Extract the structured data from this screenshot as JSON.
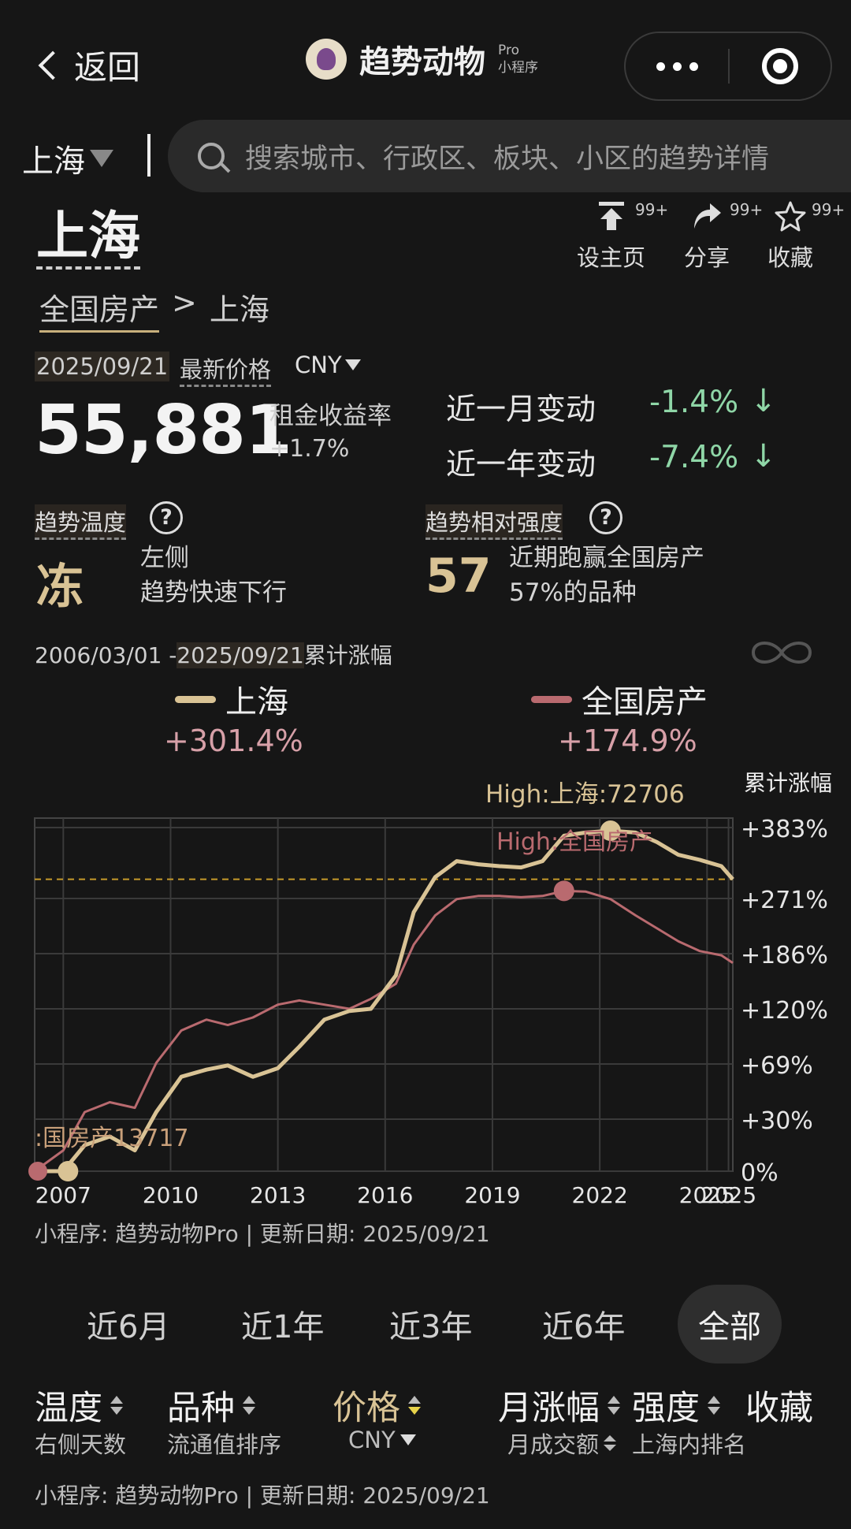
{
  "nav": {
    "back_label": "返回",
    "app_name": "趋势动物",
    "app_pro": "Pro",
    "app_sub": "小程序"
  },
  "city_selector": {
    "city": "上海"
  },
  "search": {
    "placeholder": "搜索城市、行政区、板块、小区的趋势详情"
  },
  "header": {
    "title": "上海",
    "breadcrumb_root": "全国房产",
    "breadcrumb_sep": ">",
    "breadcrumb_current": "上海",
    "actions": [
      {
        "label": "设主页",
        "badge": "99+",
        "icon": "pin-top-icon"
      },
      {
        "label": "分享",
        "badge": "99+",
        "icon": "share-icon"
      },
      {
        "label": "收藏",
        "badge": "99+",
        "icon": "star-icon"
      }
    ]
  },
  "price": {
    "date": "2025/09/21",
    "latest_label": "最新价格",
    "currency": "CNY",
    "value": "55,881",
    "rent_label": "租金收益率",
    "rent_value": "+1.7%",
    "month_label": "近一月变动",
    "month_value": "-1.4%",
    "year_label": "近一年变动",
    "year_value": "-7.4%",
    "arrow": "↓",
    "change_color": "#8fd6a7"
  },
  "metrics": {
    "temp_label": "趋势温度",
    "temp_value": "冻",
    "temp_desc1": "左侧",
    "temp_desc2": "趋势快速下行",
    "strength_label": "趋势相对强度",
    "strength_value": "57",
    "strength_desc1": "近期跑赢全国房产",
    "strength_desc2": "57%的品种",
    "help": "?"
  },
  "chart_header": {
    "range_start": "2006/03/01 -",
    "range_end": "2025/09/21",
    "range_suffix": "累计涨幅",
    "legend": [
      {
        "name": "上海",
        "value": "+301.4%",
        "color": "#d9c395"
      },
      {
        "name": "全国房产",
        "value": "+174.9%",
        "color": "#b96a6f"
      }
    ],
    "cum_label": "累计涨幅"
  },
  "chart_data": {
    "type": "line",
    "ylabel": "累计涨幅",
    "y_ticks": [
      "+383%",
      "+271%",
      "+186%",
      "+120%",
      "+69%",
      "+30%",
      "0%"
    ],
    "x_ticks": [
      "2007",
      "2010",
      "2013",
      "2016",
      "2019",
      "2022",
      "2025",
      "2025"
    ],
    "annotations": {
      "high_shanghai": "High:上海:72706",
      "high_national": "High:全国房产",
      "low_overlap": ":国房产13717"
    },
    "x": [
      2006.2,
      2007.0,
      2007.6,
      2008.3,
      2009.0,
      2009.6,
      2010.3,
      2011.0,
      2011.6,
      2012.3,
      2013.0,
      2013.6,
      2014.3,
      2015.0,
      2015.6,
      2016.3,
      2016.8,
      2017.4,
      2018.0,
      2018.6,
      2019.2,
      2019.8,
      2020.4,
      2021.0,
      2021.6,
      2022.3,
      2023.0,
      2023.6,
      2024.2,
      2024.8,
      2025.4,
      2025.72
    ],
    "series": [
      {
        "name": "上海",
        "color": "#d9c395",
        "values": [
          0,
          0,
          15,
          20,
          12,
          35,
          60,
          65,
          68,
          60,
          66,
          85,
          110,
          118,
          120,
          160,
          250,
          305,
          330,
          325,
          322,
          320,
          330,
          370,
          375,
          378,
          375,
          360,
          340,
          332,
          322,
          301.4
        ]
      },
      {
        "name": "全国房产",
        "color": "#b96a6f",
        "values": [
          0,
          12,
          35,
          42,
          38,
          70,
          100,
          110,
          105,
          112,
          125,
          130,
          125,
          120,
          132,
          150,
          200,
          245,
          270,
          275,
          275,
          273,
          275,
          283,
          282,
          270,
          245,
          225,
          205,
          190,
          184,
          174.9
        ]
      }
    ],
    "reference_line": 301.4
  },
  "chart_footer": "小程序: 趋势动物Pro | 更新日期: 2025/09/21",
  "period_tabs": [
    "近6月",
    "近1年",
    "近3年",
    "近6年",
    "全部"
  ],
  "table_header": {
    "columns": [
      {
        "label": "温度",
        "sub": "右侧天数"
      },
      {
        "label": "品种",
        "sub": "流通值排序"
      },
      {
        "label": "价格",
        "sub": "CNY"
      },
      {
        "label": "月涨幅",
        "sub": "月成交额"
      },
      {
        "label": "强度",
        "sub": "上海内排名"
      },
      {
        "label": "收藏",
        "sub": ""
      }
    ],
    "active_color": "#d9c395"
  },
  "bottom_footer": "小程序: 趋势动物Pro | 更新日期:  2025/09/21"
}
